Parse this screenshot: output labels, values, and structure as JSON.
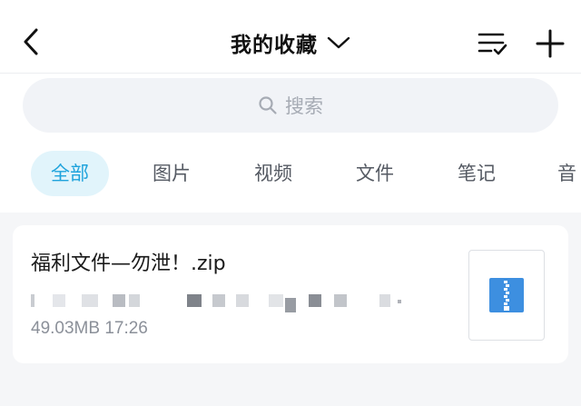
{
  "header": {
    "title": "我的收藏",
    "back_icon": "chevron-left-icon",
    "title_icon": "chevron-down-icon",
    "sort_icon": "list-check-icon",
    "add_icon": "plus-icon"
  },
  "search": {
    "placeholder": "搜索",
    "icon": "search-icon"
  },
  "tabs": [
    {
      "label": "全部",
      "active": true
    },
    {
      "label": "图片",
      "active": false
    },
    {
      "label": "视频",
      "active": false
    },
    {
      "label": "文件",
      "active": false
    },
    {
      "label": "笔记",
      "active": false
    },
    {
      "label": "音",
      "active": false
    }
  ],
  "items": [
    {
      "file_name": "福利文件—勿泄！.zip",
      "file_size": "49.03MB",
      "time": "17:26",
      "thumb_icon": "zip-file-icon"
    }
  ],
  "colors": {
    "accent": "#1fa3dc",
    "tab_active_bg": "#e1f4fb",
    "zip_blue": "#3d8fe0"
  }
}
